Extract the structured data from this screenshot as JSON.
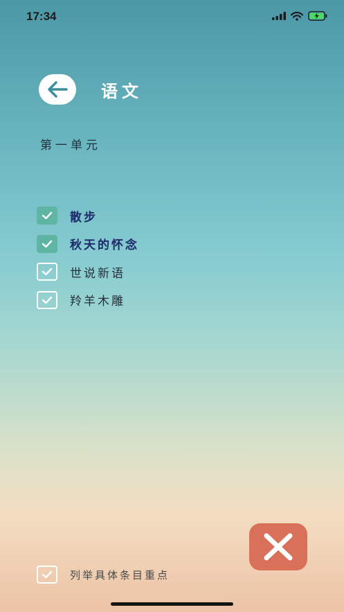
{
  "status_bar": {
    "time": "17:34"
  },
  "header": {
    "title": "语文"
  },
  "unit": {
    "title": "第一单元"
  },
  "lessons": [
    {
      "label": "散步",
      "checked": true
    },
    {
      "label": "秋天的怀念",
      "checked": true
    },
    {
      "label": "世说新语",
      "checked": false
    },
    {
      "label": "羚羊木雕",
      "checked": false
    }
  ],
  "bottom_option": {
    "label": "列举具体条目重点",
    "checked": false
  },
  "colors": {
    "checked_fill": "#5fb5a4",
    "close_button": "#d9715a",
    "selected_text": "#1c2a6b"
  }
}
